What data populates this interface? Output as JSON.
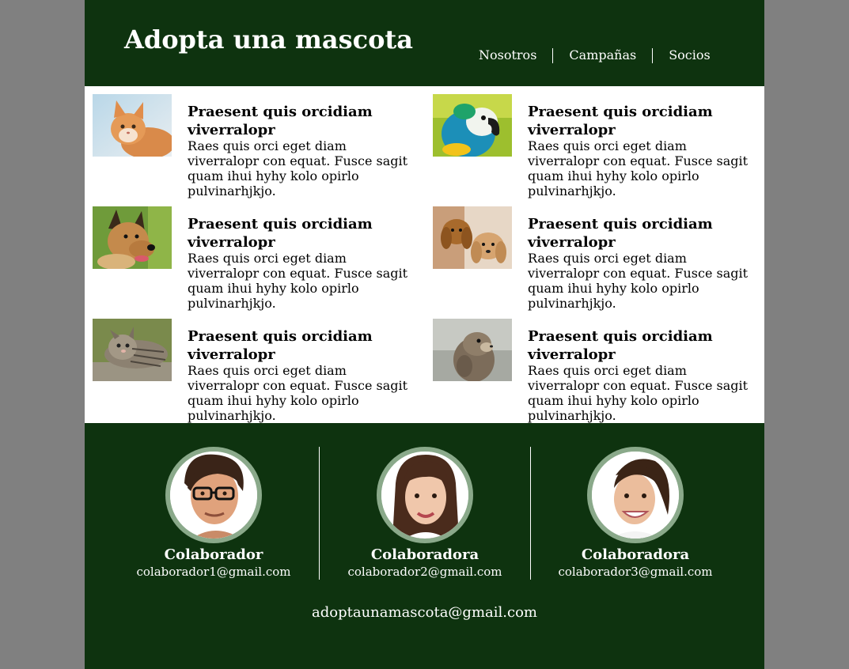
{
  "header": {
    "title": "Adopta una mascota",
    "nav": [
      "Nosotros",
      "Campañas",
      "Socios"
    ]
  },
  "articles": [
    {
      "animal": "kitten-orange",
      "title": "Praesent quis orcidiam viverralopr",
      "text": "Raes quis orci eget diam viverralopr con equat. Fusce sagit quam ihui hyhy kolo opirlo pulvinarhjkjo."
    },
    {
      "animal": "parrot",
      "title": "Praesent quis orcidiam viverralopr",
      "text": "Raes quis orci eget diam viverralopr con equat. Fusce sagit quam ihui hyhy kolo opirlo pulvinarhjkjo."
    },
    {
      "animal": "german-shepherd",
      "title": "Praesent quis orcidiam viverralopr",
      "text": "Raes quis orci eget diam viverralopr con equat. Fusce sagit quam ihui hyhy kolo opirlo pulvinarhjkjo."
    },
    {
      "animal": "puppies",
      "title": "Praesent quis orcidiam viverralopr",
      "text": "Raes quis orci eget diam viverralopr con equat. Fusce sagit quam ihui hyhy kolo opirlo pulvinarhjkjo."
    },
    {
      "animal": "tabby-cat",
      "title": "Praesent quis orcidiam viverralopr",
      "text": "Raes quis orci eget diam viverralopr con equat. Fusce sagit quam ihui hyhy kolo opirlo pulvinarhjkjo."
    },
    {
      "animal": "marmot",
      "title": "Praesent quis orcidiam viverralopr",
      "text": "Raes quis orci eget diam viverralopr con equat. Fusce sagit quam ihui hyhy kolo opirlo pulvinarhjkjo."
    }
  ],
  "team": [
    {
      "name": "Colaborador",
      "email": "colaborador1@gmail.com"
    },
    {
      "name": "Colaboradora",
      "email": "colaborador2@gmail.com"
    },
    {
      "name": "Colaboradora",
      "email": "colaborador3@gmail.com"
    }
  ],
  "footer": {
    "contact_email": "adoptaunamascota@gmail.com"
  },
  "colors": {
    "brand_green": "#0e330f",
    "avatar_ring": "#8aa98a",
    "page_background": "#808080"
  }
}
